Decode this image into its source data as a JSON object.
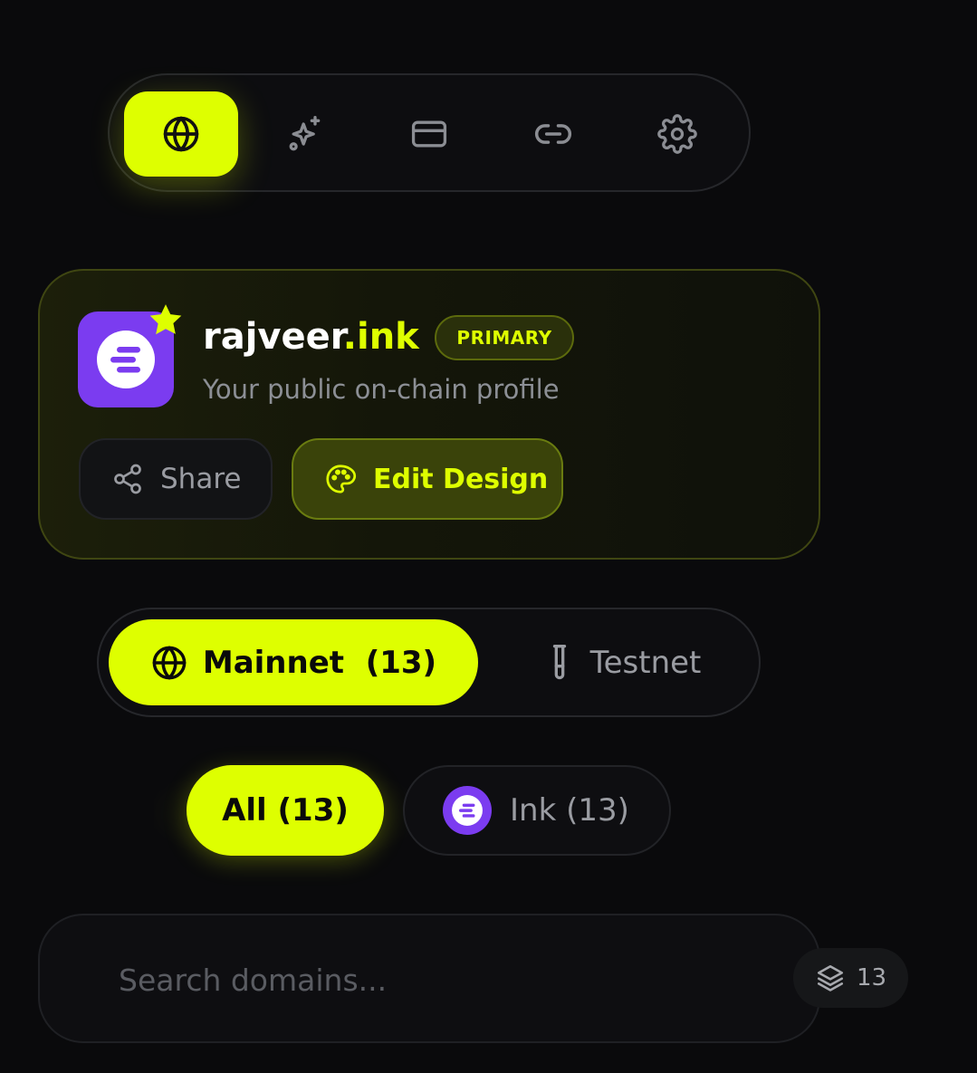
{
  "topnav": {
    "items": [
      {
        "icon": "globe-icon",
        "active": true
      },
      {
        "icon": "sparkles-icon",
        "active": false
      },
      {
        "icon": "card-icon",
        "active": false
      },
      {
        "icon": "link-icon",
        "active": false
      },
      {
        "icon": "gear-icon",
        "active": false
      }
    ]
  },
  "profile": {
    "name": "rajveer",
    "tld": ".ink",
    "badge": "PRIMARY",
    "subtitle": "Your public on-chain profile",
    "share_label": "Share",
    "edit_label": "Edit Design"
  },
  "network": {
    "mainnet_label": "Mainnet  (13)",
    "testnet_label": "Testnet"
  },
  "filters": {
    "all_label": "All (13)",
    "ink_label": "Ink (13)"
  },
  "search": {
    "placeholder": "Search domains...",
    "count": "13"
  },
  "colors": {
    "accent": "#deff00",
    "ink_purple": "#7b3cf0",
    "background": "#0a0a0c"
  }
}
